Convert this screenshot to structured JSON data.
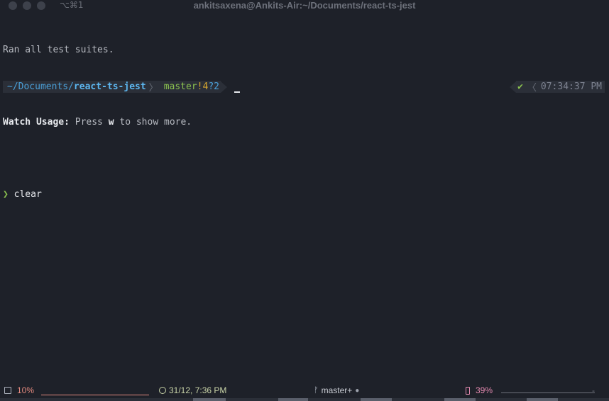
{
  "window": {
    "title": "ankitsaxena@Ankits-Air:~/Documents/react-ts-jest",
    "tab_shortcut": "⌥⌘1"
  },
  "terminal": {
    "line1": "Ran all test suites.",
    "watch_label": "Watch Usage:",
    "watch_rest": " Press ",
    "watch_key": "w",
    "watch_tail": " to show more.",
    "prompt_arrow": "❯",
    "command": "clear"
  },
  "prompt": {
    "path_prefix": "~/Documents/",
    "path_dir": "react-ts-jest",
    "chevron": "〉",
    "branch": "master",
    "modified": "!4",
    "untracked": "?2",
    "status_check": "✔",
    "right_chevron": "〈",
    "time": "07:34:37 PM"
  },
  "statusbar": {
    "cpu": "10%",
    "datetime": "31/12, 7:36 PM",
    "branch_icon": "ᚠ",
    "git": "master+",
    "git_dot": "●",
    "battery": "39%",
    "battery_trailing": "-"
  },
  "colors": {
    "background": "#1e2129",
    "prompt_green": "#8ac14f",
    "path_blue": "#4aa0d9",
    "modified_yellow": "#d8a82f",
    "cpu_red": "#e48a7f",
    "battery_pink": "#e48ab0"
  }
}
